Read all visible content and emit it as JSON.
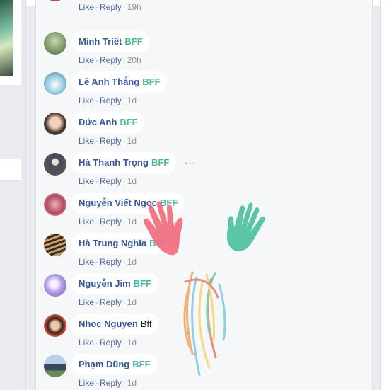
{
  "actions": {
    "like": "Like",
    "reply": "Reply",
    "separator": "·"
  },
  "comments": [
    {
      "name": "",
      "tag": "",
      "time": "19h",
      "avatar_color": "#c8463c"
    },
    {
      "name": "Minh Triết",
      "tag": "BFF",
      "time": "20h",
      "avatar_color": "#6a8a5a"
    },
    {
      "name": "Lê Anh Thắng",
      "tag": "BFF",
      "time": "1d",
      "avatar_color": "#5a9ab8"
    },
    {
      "name": "Đức Anh",
      "tag": "BFF",
      "time": "1d",
      "avatar_color": "#a08070"
    },
    {
      "name": "Hà Thanh Trọng",
      "tag": "BFF",
      "time": "1d",
      "avatar_color": "#5a5a64"
    },
    {
      "name": "Nguyễn Viết Ngọc",
      "tag": "BFF",
      "time": "1d",
      "avatar_color": "#b04a60"
    },
    {
      "name": "Hà Trung Nghĩa",
      "tag": "BFF",
      "time": "1d",
      "avatar_color": "#7a5a3a"
    },
    {
      "name": "Nguyễn Jim",
      "tag": "BFF",
      "time": "1d",
      "avatar_color": "#8a7ac8"
    },
    {
      "name": "Nhoc Nguyen",
      "tag": "Bff",
      "time": "1d",
      "avatar_color": "#c8504a"
    },
    {
      "name": "Phạm Dũng",
      "tag": "BFF",
      "time": "1d",
      "avatar_color": "#4a6a8a"
    }
  ],
  "more_label": "···",
  "colors": {
    "name": "#365899",
    "tag": "#4fb89a",
    "hand_pink": "#f06c7c",
    "hand_teal": "#4cc0a0"
  }
}
